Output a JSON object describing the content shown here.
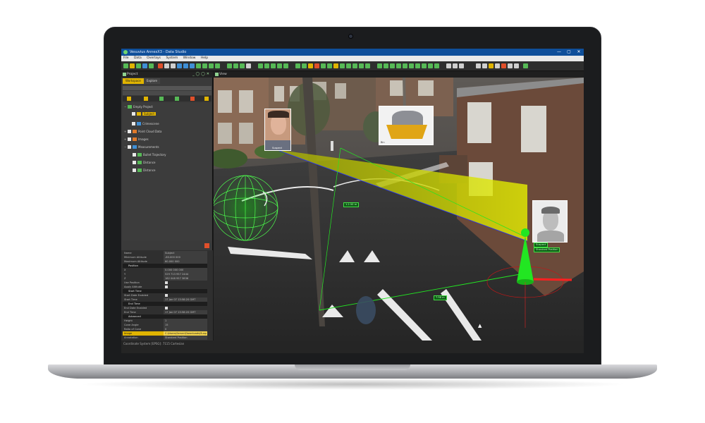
{
  "window": {
    "title": "Vesuvius AnnexX3 - Data Studio",
    "controls": [
      "—",
      "▢",
      "✕"
    ]
  },
  "menu": [
    "File",
    "Data",
    "Overlays",
    "System",
    "Window",
    "Help"
  ],
  "project_panel": {
    "title": "Project",
    "tabs": [
      "Workspace",
      "Explore"
    ],
    "tree": [
      {
        "label": "Empty Project",
        "level": 0
      },
      {
        "label": "Subject",
        "level": 1,
        "highlight": true
      },
      {
        "label": "Crimescene",
        "level": 1
      },
      {
        "label": "Point Cloud Data",
        "level": 1
      },
      {
        "label": "Images",
        "level": 1
      },
      {
        "label": "Measurements",
        "level": 1
      },
      {
        "label": "Bullet Trajectory",
        "level": 2
      },
      {
        "label": "Distance",
        "level": 2
      },
      {
        "label": "Distance",
        "level": 2
      }
    ]
  },
  "properties": [
    {
      "key": "Name",
      "value": "Subject"
    },
    {
      "key": "Minimum Altitude",
      "value": "-60.000 000"
    },
    {
      "key": "Maximum Altitude",
      "value": "60.000 000"
    },
    {
      "section": "Position"
    },
    {
      "key": "X",
      "value": "0.000 000 000"
    },
    {
      "key": "Y",
      "value": "529 713 957 2444"
    },
    {
      "key": "Z",
      "value": "182 048 957 3836"
    },
    {
      "key": "Use Position",
      "value": ""
    },
    {
      "key": "Apply Altitude",
      "value": ""
    },
    {
      "section": "Start Time"
    },
    {
      "key": "Start Date Enabled",
      "value": ""
    },
    {
      "key": "Start Time",
      "value": "17 Jan 07 13:58:20 GMT"
    },
    {
      "section": "End Time"
    },
    {
      "key": "End Date Enabled",
      "value": ""
    },
    {
      "key": "End Time",
      "value": "17 Jan 07 13:58:20 GMT"
    },
    {
      "section": "Advanced"
    },
    {
      "key": "Height",
      "value": "1"
    },
    {
      "key": "Cone Angle",
      "value": "15"
    },
    {
      "key": "Ratio of Cone",
      "value": "0"
    },
    {
      "key": "Image",
      "value": "C:\\Users\\Server\\Downloads\\Susp",
      "highlight": true
    },
    {
      "key": "Annotation",
      "value": "Standard Position"
    },
    {
      "key": "Colour",
      "value": "#10 255 010 - #00FF00"
    }
  ],
  "status_bar": "Coordinate System [EPSG]: 7115 Cartesian",
  "view": {
    "title": "View",
    "labels": {
      "distance_1": "1.2.50 m",
      "distance_2": "7.98 m",
      "suspect": "Suspect",
      "standard_position": "Standard Position",
      "photo_caption_1": "Suspect",
      "photo_caption_2": "Bin"
    }
  },
  "colors": {
    "accent": "#e0b400",
    "titlebar": "#0f4f9a",
    "marker_green": "#22e622",
    "trajectory_yellow": "#d9e800"
  }
}
